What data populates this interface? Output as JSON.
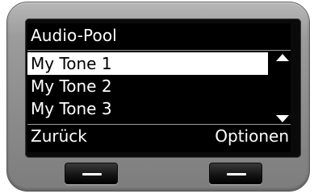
{
  "screen": {
    "title": "Audio-Pool",
    "list": [
      {
        "label": "My Tone 1",
        "selected": true
      },
      {
        "label": "My Tone 2",
        "selected": false
      },
      {
        "label": "My Tone 3",
        "selected": false
      }
    ],
    "scroll_up_icon": "triangle-up",
    "scroll_down_icon": "triangle-down"
  },
  "softkeys": {
    "left_label": "Zurück",
    "right_label": "Optionen"
  },
  "colors": {
    "screen_background": "#000000",
    "screen_text": "#ffffff",
    "selection_background": "#ffffff",
    "selection_text": "#000000",
    "device_body": "#9c9c9c"
  }
}
